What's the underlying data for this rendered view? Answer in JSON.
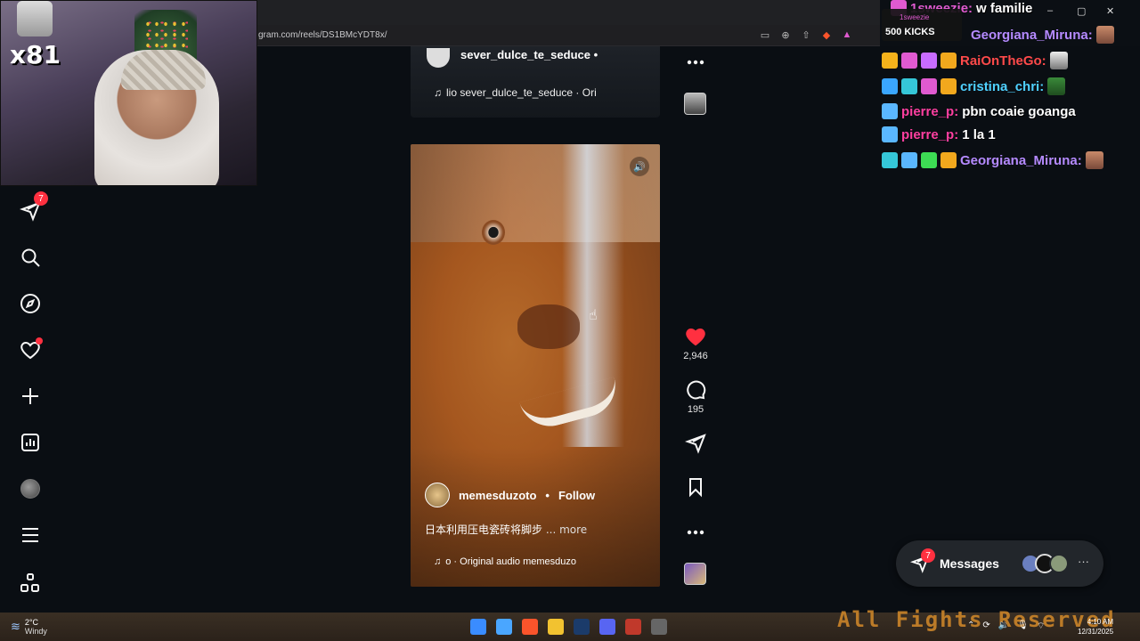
{
  "browser": {
    "url": "gram.com/reels/DS1BMcYDT8x/"
  },
  "stream": {
    "multiplier": "x81",
    "kicks": {
      "user": "1sweezie",
      "amount": "500 KICKS"
    }
  },
  "sidebar": {
    "items": [
      {
        "name": "messages",
        "icon": "send-icon",
        "badge": "7"
      },
      {
        "name": "search",
        "icon": "search-icon"
      },
      {
        "name": "explore",
        "icon": "compass-icon"
      },
      {
        "name": "notifications",
        "icon": "heart-icon"
      },
      {
        "name": "create",
        "icon": "plus-icon"
      },
      {
        "name": "dashboard",
        "icon": "chart-icon"
      },
      {
        "name": "profile",
        "icon": "avatar-icon"
      },
      {
        "name": "more",
        "icon": "menu-icon"
      },
      {
        "name": "also-from-meta",
        "icon": "grid-icon"
      }
    ]
  },
  "prev_reel": {
    "username": "sever_dulce_te_seduce",
    "separator": "•",
    "audio": "lio  sever_dulce_te_seduce · Ori"
  },
  "reel": {
    "username": "memesduzoto",
    "separator": "•",
    "follow_label": "Follow",
    "caption": "日本利用压电瓷砖将脚步",
    "more_label": "... more",
    "audio": "o · Original audio  memesduzo",
    "likes": "2,946",
    "comments": "195"
  },
  "chat": {
    "lines": [
      {
        "user": "1sweezie:",
        "text": "w familie",
        "user_color": "#e05ad0"
      },
      {
        "user": "Georgiana_Miruna:",
        "text": "",
        "user_color": "#b58aff"
      },
      {
        "user": "RaiOnTheGo:",
        "text": "",
        "user_color": "#ff4a4a"
      },
      {
        "user": "cristina_chri:",
        "text": "",
        "user_color": "#4fd1ff"
      },
      {
        "user": "pierre_p:",
        "text": "pbn coaie goanga",
        "user_color": "#ff3fa0"
      },
      {
        "user": "pierre_p:",
        "text": "1 la 1",
        "user_color": "#ff3fa0"
      },
      {
        "user": "Georgiana_Miruna:",
        "text": "",
        "user_color": "#b58aff"
      }
    ]
  },
  "messages_pill": {
    "label": "Messages",
    "badge": "7"
  },
  "taskbar": {
    "temp": "2°C",
    "condition": "Windy",
    "banner": "All Fights Reserved",
    "time": "4:10 AM",
    "date": "12/31/2025"
  },
  "colors": {
    "accent_red": "#ff3040",
    "background": "#0a0e13"
  }
}
